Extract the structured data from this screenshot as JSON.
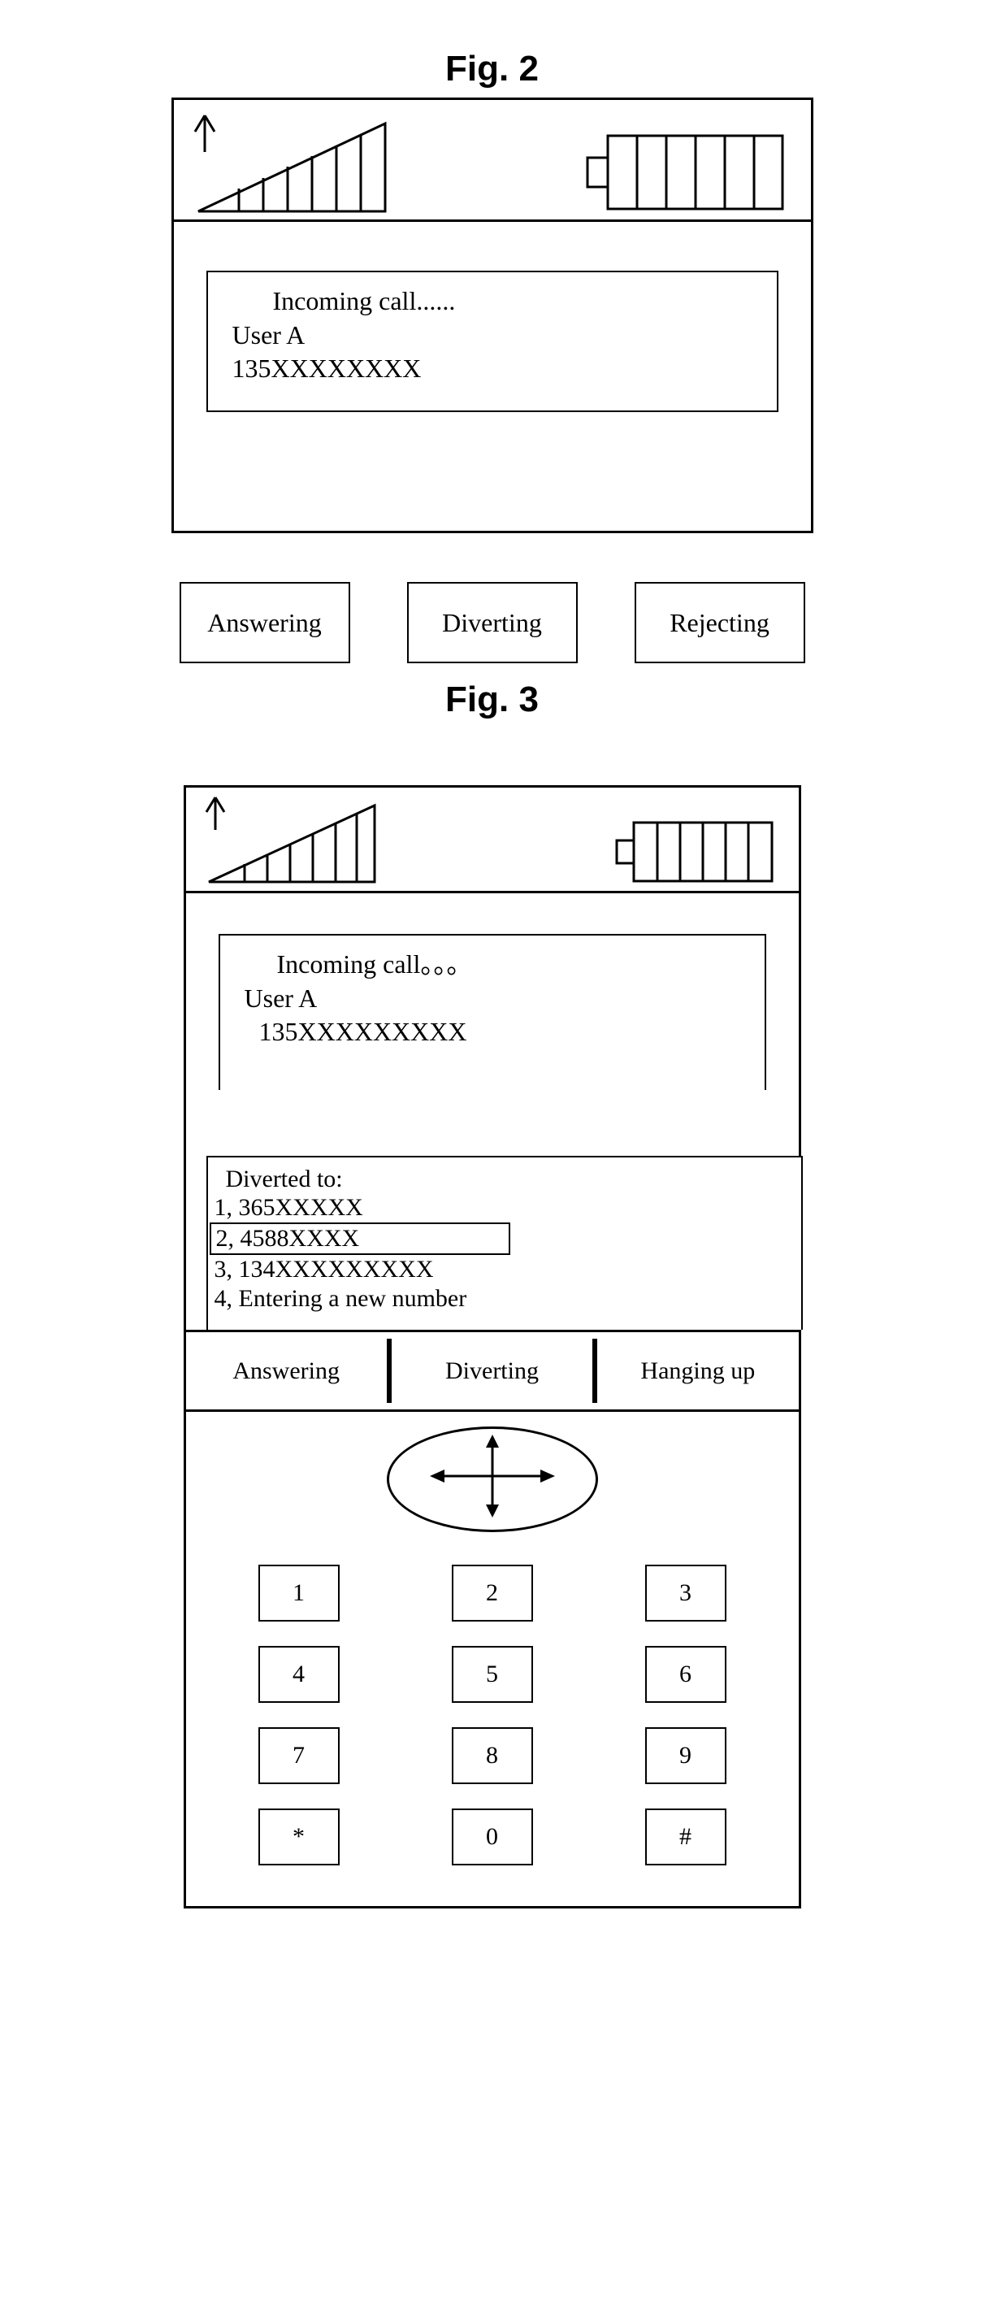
{
  "fig2": {
    "title": "Fig. 2",
    "call_status": "Incoming call......",
    "caller_name": "User A",
    "caller_number": "135XXXXXXXX",
    "buttons": {
      "answer": "Answering",
      "divert": "Diverting",
      "reject": "Rejecting"
    }
  },
  "fig3": {
    "title": "Fig. 3",
    "call_status": "Incoming call。。。",
    "caller_name": "User A",
    "caller_number": "135XXXXXXXXX",
    "popup": {
      "title": "Diverted  to:",
      "items": [
        "1,   365XXXXX",
        "2,   4588XXXX",
        "3,   134XXXXXXXXX",
        "4,   Entering a new number"
      ],
      "selected_index": 1
    },
    "softkeys": {
      "left": "Answering",
      "mid": "Diverting",
      "right": "Hanging up"
    },
    "keypad": [
      "1",
      "2",
      "3",
      "4",
      "5",
      "6",
      "7",
      "8",
      "9",
      "*",
      "0",
      "#"
    ]
  }
}
